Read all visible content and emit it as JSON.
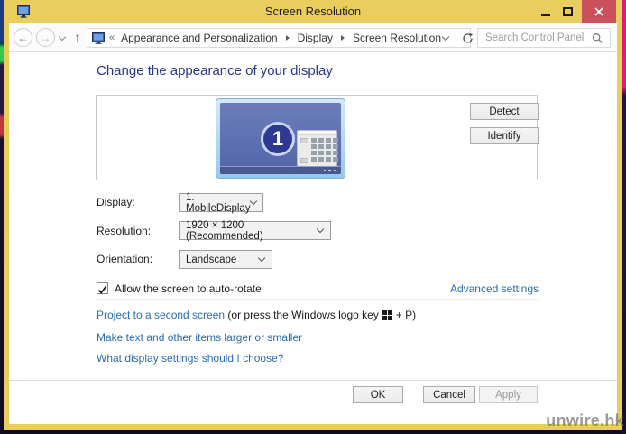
{
  "window": {
    "title": "Screen Resolution"
  },
  "nav": {
    "breadcrumb_prefix": "«",
    "breadcrumb": [
      {
        "label": "Appearance and Personalization"
      },
      {
        "label": "Display"
      },
      {
        "label": "Screen Resolution"
      }
    ],
    "search_placeholder": "Search Control Panel"
  },
  "main": {
    "heading": "Change the appearance of your display",
    "preview": {
      "monitor_number": "1",
      "detect_label": "Detect",
      "identify_label": "Identify"
    },
    "fields": [
      {
        "label": "Display:",
        "value": "1. MobileDisplay"
      },
      {
        "label": "Resolution:",
        "value": "1920 × 1200 (Recommended)"
      },
      {
        "label": "Orientation:",
        "value": "Landscape"
      }
    ],
    "auto_rotate_label": "Allow the screen to auto-rotate",
    "auto_rotate_checked": true,
    "advanced_settings_label": "Advanced settings",
    "project_link": "Project to a second screen",
    "project_text_pre": " (or press the Windows logo key",
    "project_text_post": "+ P)",
    "make_text_link": "Make text and other items larger or smaller",
    "what_settings_link": "What display settings should I choose?",
    "buttons": {
      "ok": "OK",
      "cancel": "Cancel",
      "apply": "Apply"
    }
  },
  "watermark": "unwire.hk",
  "colors": {
    "titlebar_yellow": "#e9ce5f",
    "close_button_red": "#cb505c",
    "heading_blue": "#27388b",
    "link_blue": "#2a6cb5",
    "monitor_screen_blue": "#5b6db0",
    "monitor_frame_blue": "#a7d2ee",
    "desktop_magenta": "#e2197a",
    "desktop_green": "#2ecb4e"
  }
}
